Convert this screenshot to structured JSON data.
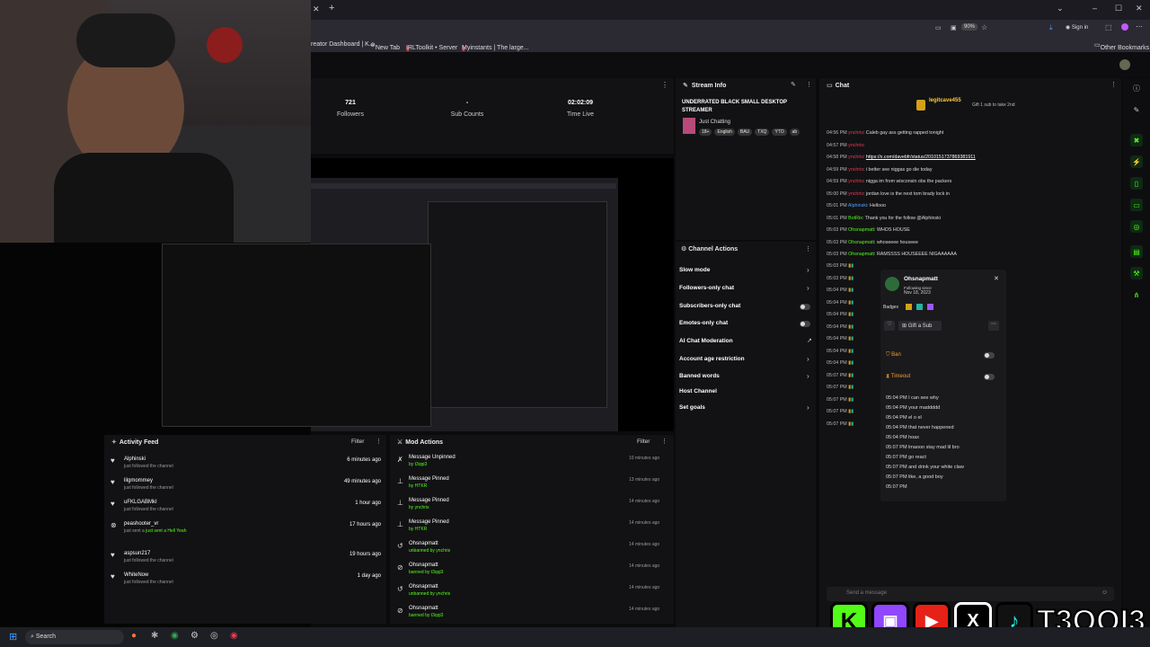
{
  "browser": {
    "bookmarks": [
      "reator Dashboard | K...",
      "New Tab",
      "IRLToolkit • Server",
      "Myinstants | The large..."
    ],
    "other_bookmarks": "Other Bookmarks",
    "zoom": "90%",
    "sign_in": "Sign in"
  },
  "stats": [
    {
      "value": "721",
      "label": "Followers"
    },
    {
      "value": "-",
      "label": "Sub Counts"
    },
    {
      "value": "02:02:09",
      "label": "Time Live"
    }
  ],
  "stream_info": {
    "title": "Stream Info",
    "stream_title": "UNDERRATED BLACK SMALL DESKTOP STREAMER",
    "category": "Just Chatting",
    "tags": [
      "18+",
      "English",
      "BAU",
      "TXQ",
      "YTO",
      "ab"
    ]
  },
  "channel_actions": {
    "title": "Channel Actions",
    "items": [
      "Slow mode",
      "Followers-only chat",
      "Subscribers-only chat",
      "Emotes-only chat",
      "AI Chat Moderation",
      "Account age restriction",
      "Banned words",
      "Host Channel",
      "Set goals"
    ]
  },
  "activity_feed": {
    "title": "Activity Feed",
    "filter": "Filter",
    "items": [
      {
        "user": "Alphinski",
        "action": "just followed the channel",
        "time": "6 minutes ago"
      },
      {
        "user": "lilgmommey",
        "action": "just followed the channel",
        "time": "49 minutes ago"
      },
      {
        "user": "uFKLGABMkI",
        "action": "just followed the channel",
        "time": "1 hour ago"
      },
      {
        "user": "peashooter_vr",
        "action": "just sent a Hell Yeah",
        "time": "17 hours ago"
      },
      {
        "user": "aspsun217",
        "action": "just followed the channel",
        "time": "19 hours ago"
      },
      {
        "user": "WhiteNow",
        "action": "just followed the channel",
        "time": "1 day ago"
      }
    ]
  },
  "mod_actions": {
    "title": "Mod Actions",
    "filter": "Filter",
    "items": [
      {
        "title": "Message Unpinned",
        "by": "by t3qqi3",
        "time": "10 minutes ago"
      },
      {
        "title": "Message Pinned",
        "by": "by HTKR",
        "time": "13 minutes ago"
      },
      {
        "title": "Message Pinned",
        "by": "by ynchris",
        "time": "14 minutes ago"
      },
      {
        "title": "Message Pinned",
        "by": "by HTKR",
        "time": "14 minutes ago"
      },
      {
        "title": "Ohsnapmatt",
        "by": "unbanned by ynchris",
        "time": "14 minutes ago"
      },
      {
        "title": "Ohsnapmatt",
        "by": "banned by t3qqi3",
        "time": "14 minutes ago"
      },
      {
        "title": "Ohsnapmatt",
        "by": "unbanned by ynchris",
        "time": "14 minutes ago"
      },
      {
        "title": "Ohsnapmatt",
        "by": "banned by t3qqi3",
        "time": "14 minutes ago"
      }
    ]
  },
  "chat": {
    "title": "Chat",
    "gifter": "legitcave455",
    "gift_note": "Gift 1 sub to take 2nd",
    "input_placeholder": "Send a message",
    "messages": [
      {
        "time": "04:56 PM",
        "user": "ynchris",
        "text": "Caleb gay ass getting rapped tonight"
      },
      {
        "time": "04:57 PM",
        "user": "ynchris",
        "text": ""
      },
      {
        "time": "04:58 PM",
        "user": "ynchris",
        "text": "https://x.com/davebfr/status/2010151737869381911"
      },
      {
        "time": "04:59 PM",
        "user": "ynchris",
        "text": "i better see niggas go die today"
      },
      {
        "time": "04:59 PM",
        "user": "ynchris",
        "text": "nigga im from wisconsin obs the packers"
      },
      {
        "time": "05:00 PM",
        "user": "ynchris",
        "text": "jordan love is the next tom brady lock in"
      },
      {
        "time": "05:01 PM",
        "user": "Alphinski",
        "text": "Hellooo"
      },
      {
        "time": "05:01 PM",
        "user": "BotRix",
        "text": "Thank you for the follow @Alphinski"
      },
      {
        "time": "05:03 PM",
        "user": "Ohsnapmatt",
        "text": "WHOS HOUSE"
      },
      {
        "time": "05:03 PM",
        "user": "Ohsnapmatt",
        "text": "whoseeee houseee"
      },
      {
        "time": "05:03 PM",
        "user": "Ohsnapmatt",
        "text": "RAMSSSS HOUSEEEE NIGAAAAAA"
      }
    ],
    "more_times": [
      "05:03 PM",
      "05:03 PM",
      "05:04 PM",
      "05:04 PM",
      "05:04 PM",
      "05:04 PM",
      "05:04 PM",
      "05:04 PM",
      "05:04 PM",
      "05:07 PM",
      "05:07 PM",
      "05:07 PM",
      "05:07 PM",
      "05:07 PM"
    ]
  },
  "user_card": {
    "name": "Ohsnapmatt",
    "following_label": "Following since",
    "following_date": "Nov 18, 2023",
    "badges_label": "Badges",
    "gift_button": "Gift a Sub",
    "ban": "Ban",
    "timeout": "Timeout",
    "history": [
      "05:04 PM I can see why",
      "05:04 PM your maddddd",
      "05:04 PM el o el",
      "05:04 PM that never happened",
      "05:04 PM hoax",
      "05:07 PM lmaooo stay mad lil bro",
      "05:07 PM go react",
      "05:07 PM and drink your white claw",
      "05:07 PM like, a good boy",
      "05:07 PM"
    ]
  },
  "branding": {
    "handle": "T3QQI3",
    "k": "K"
  },
  "taskbar": {
    "search": "Search"
  },
  "colors": {
    "accent": "#53fc18",
    "panel": "#121214",
    "background": "#0b0b0c"
  }
}
